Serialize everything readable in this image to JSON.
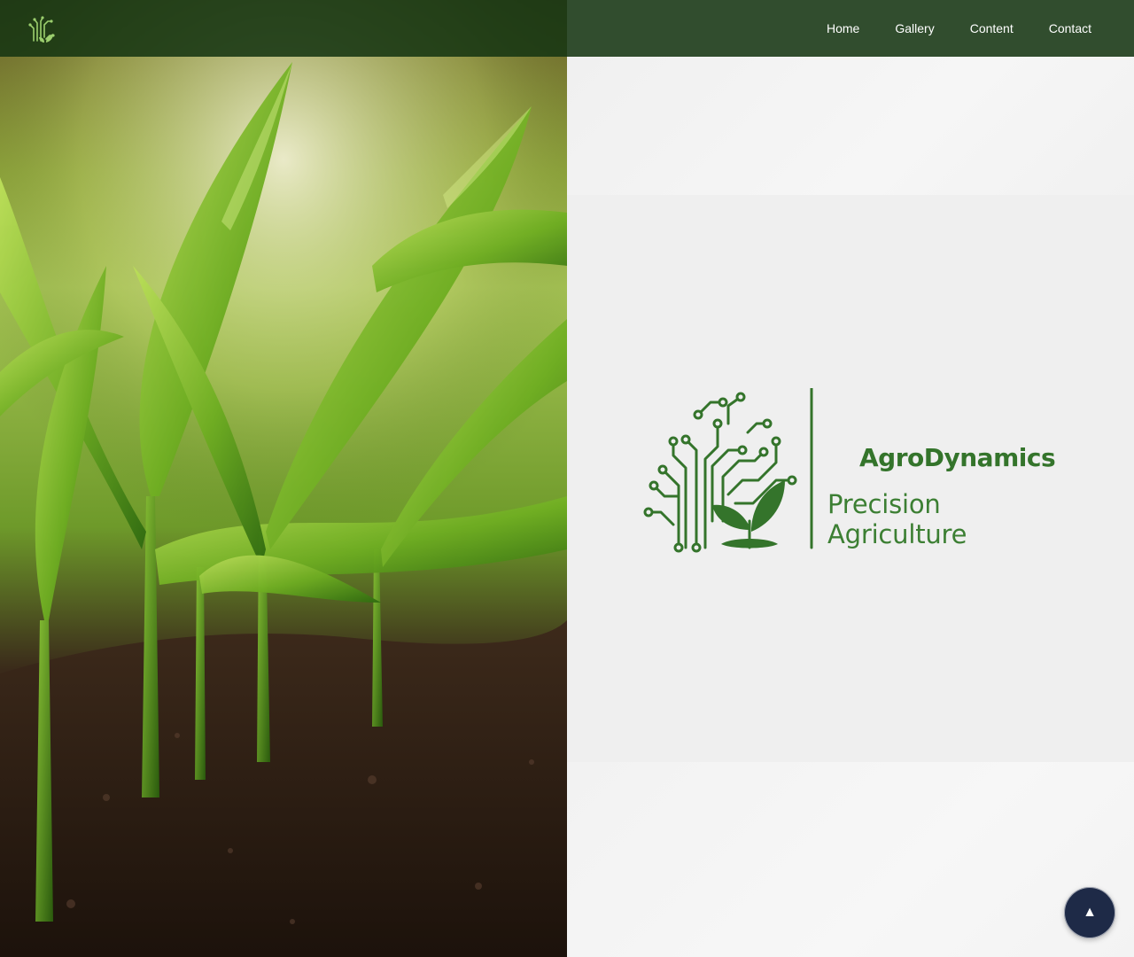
{
  "header": {
    "logo_icon": "tree-circuit-logo-icon"
  },
  "nav": {
    "items": [
      {
        "label": "Home"
      },
      {
        "label": "Gallery"
      },
      {
        "label": "Content"
      },
      {
        "label": "Contact"
      }
    ]
  },
  "hero_image": {
    "subject": "young corn sprouts growing in dark soil"
  },
  "brand": {
    "title": "AgroDynamics",
    "subtitle": "Precision Agriculture",
    "logo_icon": "tree-circuit-plant-icon",
    "color": "#34742b"
  },
  "back_to_top": {
    "glyph": "▲",
    "icon": "arrow-up-icon",
    "color": "#1e2a47"
  },
  "colors": {
    "header_bg": "#163612",
    "panel_bg": "#efefef"
  }
}
